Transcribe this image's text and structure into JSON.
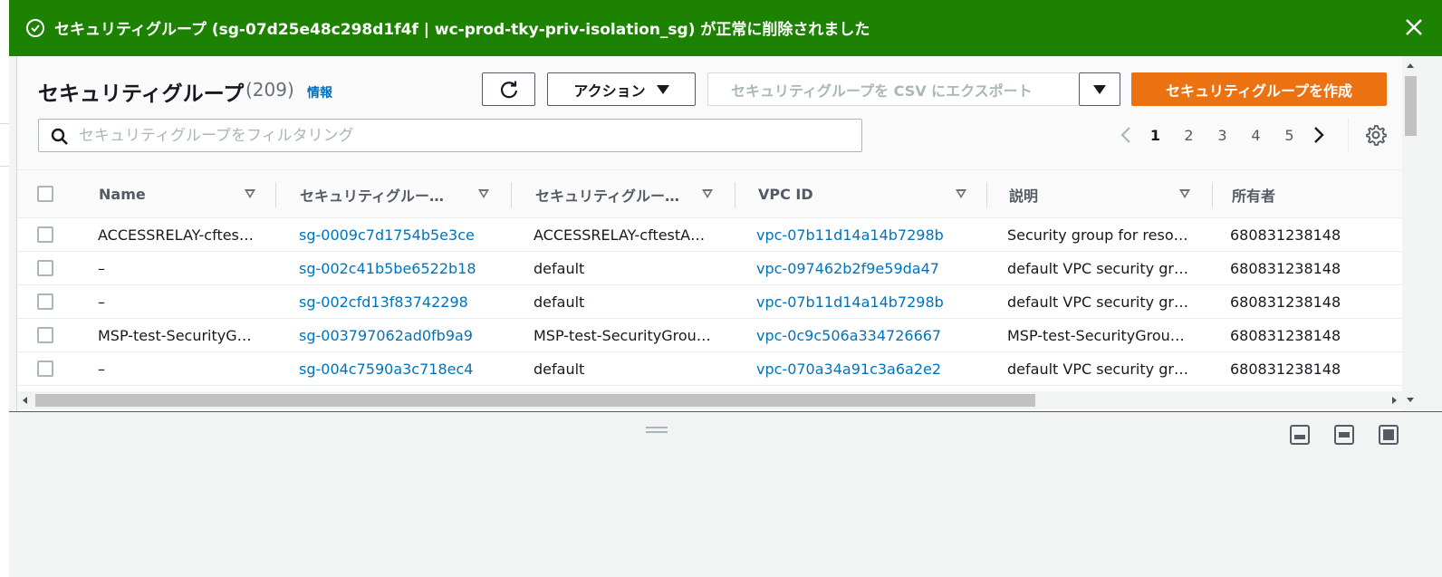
{
  "flash": {
    "message": "セキュリティグループ (sg-07d25e48c298d1f4f | wc-prod-tky-priv-isolation_sg) が正常に削除されました",
    "icon": "success-check-icon",
    "color": "#1d8102"
  },
  "header": {
    "title": "セキュリティグループ",
    "count": "(209)",
    "info_link": "情報",
    "actions_label": "アクション",
    "export_label": "セキュリティグループを CSV にエクスポート",
    "create_label": "セキュリティグループを作成",
    "create_color": "#ec7211"
  },
  "filter": {
    "placeholder": "セキュリティグループをフィルタリング",
    "value": ""
  },
  "pagination": {
    "pages": [
      "1",
      "2",
      "3",
      "4",
      "5"
    ],
    "current": "1"
  },
  "table": {
    "columns": [
      "Name",
      "セキュリティグルー…",
      "セキュリティグルー…",
      "VPC ID",
      "説明",
      "所有者"
    ],
    "rows": [
      {
        "name": "ACCESSRELAY-cftes…",
        "sg_id": "sg-0009c7d1754b5e3ce",
        "sg_name": "ACCESSRELAY-cftestA…",
        "vpc_id": "vpc-07b11d14a14b7298b",
        "description": "Security group for reso…",
        "owner": "680831238148"
      },
      {
        "name": "–",
        "sg_id": "sg-002c41b5be6522b18",
        "sg_name": "default",
        "vpc_id": "vpc-097462b2f9e59da47",
        "description": "default VPC security gr…",
        "owner": "680831238148"
      },
      {
        "name": "–",
        "sg_id": "sg-002cfd13f83742298",
        "sg_name": "default",
        "vpc_id": "vpc-07b11d14a14b7298b",
        "description": "default VPC security gr…",
        "owner": "680831238148"
      },
      {
        "name": "MSP-test-SecurityG…",
        "sg_id": "sg-003797062ad0fb9a9",
        "sg_name": "MSP-test-SecurityGrou…",
        "vpc_id": "vpc-0c9c506a334726667",
        "description": "MSP-test-SecurityGrou…",
        "owner": "680831238148"
      },
      {
        "name": "–",
        "sg_id": "sg-004c7590a3c718ec4",
        "sg_name": "default",
        "vpc_id": "vpc-070a34a91c3a6a2e2",
        "description": "default VPC security gr…",
        "owner": "680831238148"
      }
    ]
  },
  "icons": {
    "refresh": "refresh-icon",
    "search": "search-icon",
    "settings": "gear-icon",
    "close": "close-icon"
  }
}
